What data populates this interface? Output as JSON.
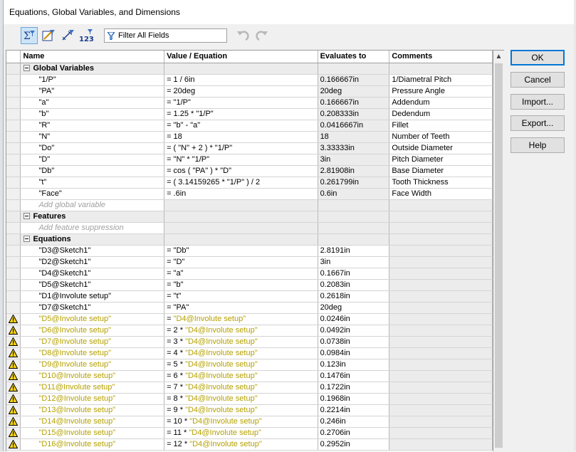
{
  "window": {
    "title": "Equations, Global Variables, and Dimensions"
  },
  "toolbar": {
    "filter_placeholder": "Filter All Fields",
    "buttons": [
      "equation-view-icon",
      "sketch-equation-view-icon",
      "dimension-view-icon",
      "ordered-view-icon",
      "undo-icon",
      "redo-icon"
    ]
  },
  "columns": [
    "Name",
    "Value / Equation",
    "Evaluates to",
    "Comments"
  ],
  "sections": {
    "global_variables": "Global Variables",
    "features": "Features",
    "equations": "Equations"
  },
  "global_variables": [
    {
      "name": "\"1/P\"",
      "value": "= 1 / 6in",
      "evaluates": "0.166667in",
      "comment": "1/Diametral Pitch"
    },
    {
      "name": "\"PA\"",
      "value": "= 20deg",
      "evaluates": "20deg",
      "comment": "Pressure Angle"
    },
    {
      "name": "\"a\"",
      "value": "= \"1/P\"",
      "evaluates": "0.166667in",
      "comment": "Addendum"
    },
    {
      "name": "\"b\"",
      "value": "= 1.25 * \"1/P\"",
      "evaluates": "0.208333in",
      "comment": "Dedendum"
    },
    {
      "name": "\"R\"",
      "value": "= \"b\" - \"a\"",
      "evaluates": "0.0416667in",
      "comment": "Fillet"
    },
    {
      "name": "\"N\"",
      "value": "= 18",
      "evaluates": "18",
      "comment": "Number of Teeth"
    },
    {
      "name": "\"Do\"",
      "value": "= ( \"N\" + 2 ) * \"1/P\"",
      "evaluates": "3.33333in",
      "comment": "Outside Diameter"
    },
    {
      "name": "\"D\"",
      "value": "= \"N\" * \"1/P\"",
      "evaluates": "3in",
      "comment": "Pitch Diameter"
    },
    {
      "name": "\"Db\"",
      "value": "= cos ( \"PA\" ) * \"D\"",
      "evaluates": "2.81908in",
      "comment": "Base Diameter"
    },
    {
      "name": "\"t\"",
      "value": "= ( 3.14159265 * \"1/P\" ) / 2",
      "evaluates": "0.261799in",
      "comment": "Tooth Thickness"
    },
    {
      "name": "\"Face\"",
      "value": "= .6in",
      "evaluates": "0.6in",
      "comment": "Face Width"
    }
  ],
  "add_global_variable": "Add global variable",
  "add_feature_suppression": "Add feature suppression",
  "equations": [
    {
      "warn": false,
      "name": "\"D3@Sketch1\"",
      "value": "= \"Db\"",
      "evaluates": "2.8191in"
    },
    {
      "warn": false,
      "name": "\"D2@Sketch1\"",
      "value": "= \"D\"",
      "evaluates": "3in"
    },
    {
      "warn": false,
      "name": "\"D4@Sketch1\"",
      "value": "= \"a\"",
      "evaluates": "0.1667in"
    },
    {
      "warn": false,
      "name": "\"D5@Sketch1\"",
      "value": "= \"b\"",
      "evaluates": "0.2083in"
    },
    {
      "warn": false,
      "name": "\"D1@Involute setup\"",
      "value": "= \"t\"",
      "evaluates": "0.2618in"
    },
    {
      "warn": false,
      "name": "\"D7@Sketch1\"",
      "value": "= \"PA\"",
      "evaluates": "20deg"
    },
    {
      "warn": true,
      "name": "\"D5@Involute setup\"",
      "prefix": "= ",
      "ref": "\"D4@Involute setup\"",
      "evaluates": "0.0246in"
    },
    {
      "warn": true,
      "name": "\"D6@Involute setup\"",
      "prefix": "= 2 * ",
      "ref": "\"D4@Involute setup\"",
      "evaluates": "0.0492in"
    },
    {
      "warn": true,
      "name": "\"D7@Involute setup\"",
      "prefix": "= 3 * ",
      "ref": "\"D4@Involute setup\"",
      "evaluates": "0.0738in"
    },
    {
      "warn": true,
      "name": "\"D8@Involute setup\"",
      "prefix": "= 4 * ",
      "ref": "\"D4@Involute setup\"",
      "evaluates": "0.0984in"
    },
    {
      "warn": true,
      "name": "\"D9@Involute setup\"",
      "prefix": "= 5 * ",
      "ref": "\"D4@Involute setup\"",
      "evaluates": "0.123in"
    },
    {
      "warn": true,
      "name": "\"D10@Involute setup\"",
      "prefix": "= 6 * ",
      "ref": "\"D4@Involute setup\"",
      "evaluates": "0.1476in"
    },
    {
      "warn": true,
      "name": "\"D11@Involute setup\"",
      "prefix": "= 7 * ",
      "ref": "\"D4@Involute setup\"",
      "evaluates": "0.1722in"
    },
    {
      "warn": true,
      "name": "\"D12@Involute setup\"",
      "prefix": "= 8 * ",
      "ref": "\"D4@Involute setup\"",
      "evaluates": "0.1968in"
    },
    {
      "warn": true,
      "name": "\"D13@Involute setup\"",
      "prefix": "= 9 * ",
      "ref": "\"D4@Involute setup\"",
      "evaluates": "0.2214in"
    },
    {
      "warn": true,
      "name": "\"D14@Involute setup\"",
      "prefix": "= 10 * ",
      "ref": "\"D4@Involute setup\"",
      "evaluates": "0.246in"
    },
    {
      "warn": true,
      "name": "\"D15@Involute setup\"",
      "prefix": "= 11 * ",
      "ref": "\"D4@Involute setup\"",
      "evaluates": "0.2706in"
    },
    {
      "warn": true,
      "name": "\"D16@Involute setup\"",
      "prefix": "= 12 * ",
      "ref": "\"D4@Involute setup\"",
      "evaluates": "0.2952in"
    }
  ],
  "side_buttons": {
    "ok": "OK",
    "cancel": "Cancel",
    "import": "Import...",
    "export": "Export...",
    "help": "Help"
  },
  "colors": {
    "warning_text": "#b5a100",
    "accent": "#0078d7",
    "grid_grey": "#ececec"
  }
}
